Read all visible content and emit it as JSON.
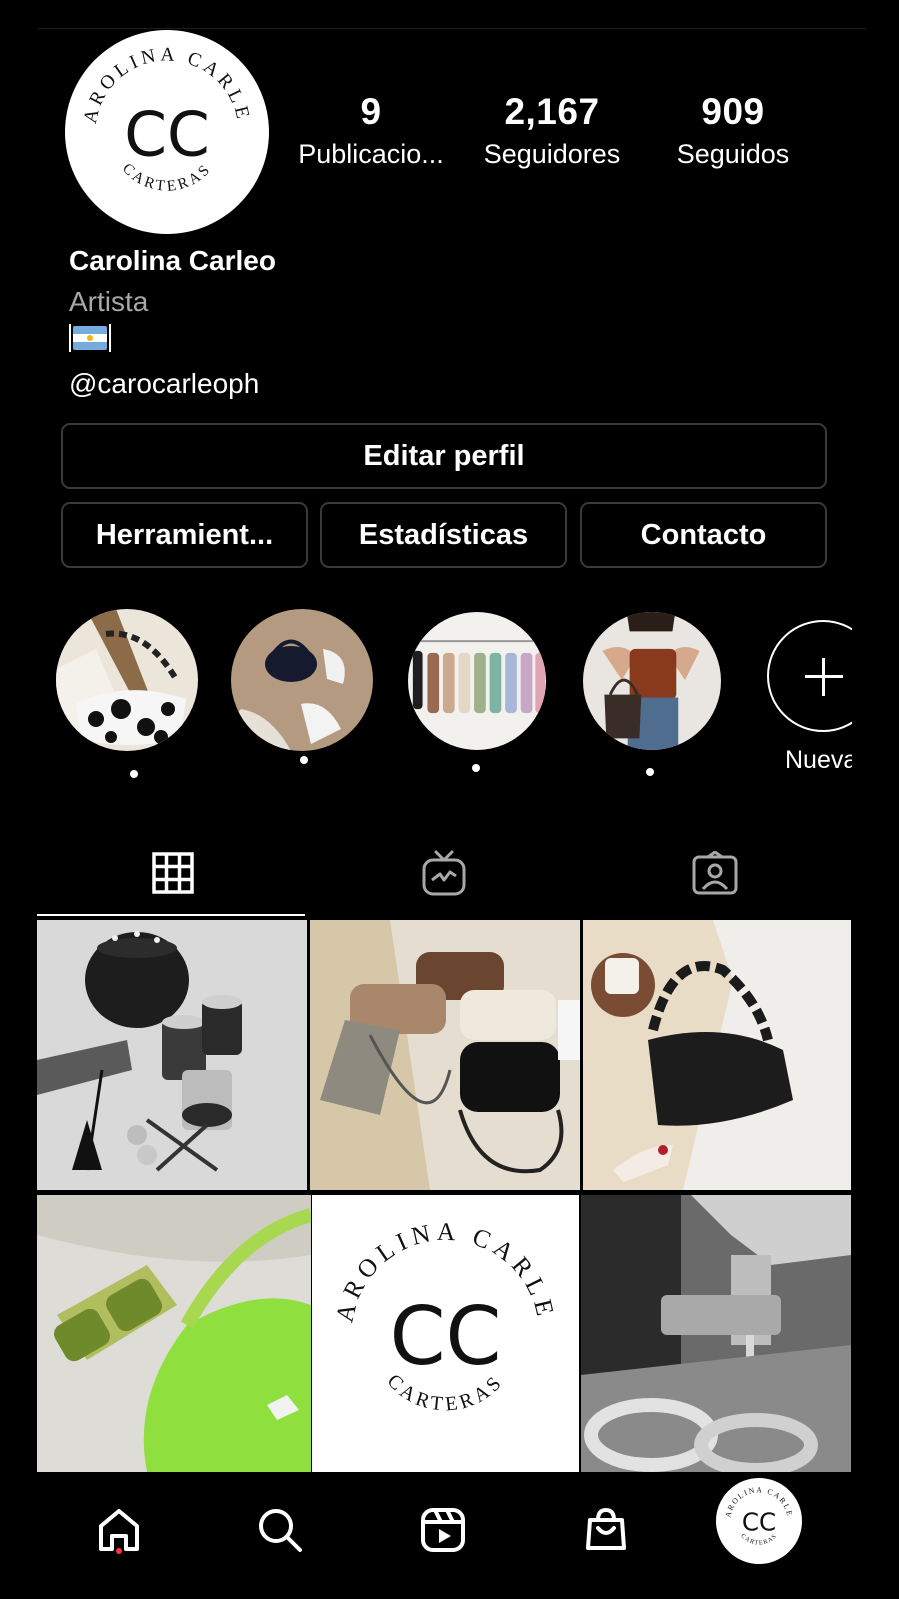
{
  "logo": {
    "ring_top": "CAROLINA CARLEO",
    "initials": "CC",
    "ring_bottom": "CARTERAS"
  },
  "stats": [
    {
      "value": "9",
      "label": "Publicacio..."
    },
    {
      "value": "2,167",
      "label": "Seguidores"
    },
    {
      "value": "909",
      "label": "Seguidos"
    }
  ],
  "bio": {
    "name": "Carolina Carleo",
    "category": "Artista",
    "flag_icon": "argentina-flag-icon",
    "handle": "@carocarleoph"
  },
  "buttons": {
    "edit": "Editar perfil",
    "tools": "Herramient...",
    "stats": "Estadísticas",
    "contact": "Contacto"
  },
  "highlights": {
    "new_label": "Nueva"
  },
  "tabs": [
    "grid-icon",
    "igtv-icon",
    "tagged-icon"
  ],
  "nav": [
    "home-icon",
    "search-icon",
    "reels-icon",
    "shop-icon",
    "profile-avatar"
  ],
  "colors": {
    "background": "#000000",
    "text": "#ffffff",
    "muted": "#a8a8a8",
    "notification": "#ff3040"
  }
}
